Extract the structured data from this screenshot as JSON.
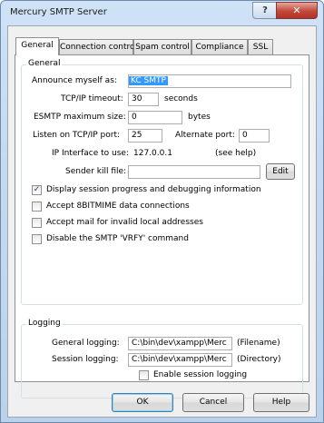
{
  "window": {
    "title": "Mercury SMTP Server",
    "close_glyph": "✕",
    "help_glyph": "?"
  },
  "tabs": [
    "General",
    "Connection control",
    "Spam control",
    "Compliance",
    "SSL"
  ],
  "general": {
    "group_label": "General",
    "announce_label": "Announce myself as:",
    "announce_value": "KC SMTP",
    "timeout_label": "TCP/IP timeout:",
    "timeout_value": "30",
    "timeout_unit": "seconds",
    "esmtp_label": "ESMTP maximum size:",
    "esmtp_value": "0",
    "esmtp_unit": "bytes",
    "port_label": "Listen on TCP/IP port:",
    "port_value": "25",
    "alt_port_label": "Alternate port:",
    "alt_port_value": "0",
    "ip_label": "IP Interface to use:",
    "ip_value": "127.0.0.1",
    "see_help": "(see help)",
    "killfile_label": "Sender kill file:",
    "killfile_value": "",
    "edit_button": "Edit",
    "checkboxes": [
      {
        "label": "Display session progress and debugging information",
        "checked": true
      },
      {
        "label": "Accept 8BITMIME data connections",
        "checked": false
      },
      {
        "label": "Accept mail for invalid local addresses",
        "checked": false
      },
      {
        "label": "Disable the SMTP 'VRFY' command",
        "checked": false
      }
    ],
    "check_glyph": "✓"
  },
  "logging": {
    "group_label": "Logging",
    "general_label": "General logging:",
    "general_value": "C:\\bin\\dev\\xampp\\Merc",
    "general_hint": "(Filename)",
    "session_label": "Session logging:",
    "session_value": "C:\\bin\\dev\\xampp\\Merc",
    "session_hint": "(Directory)",
    "enable_label": "Enable session logging",
    "enable_checked": false
  },
  "buttons": {
    "ok": "OK",
    "cancel": "Cancel",
    "help": "Help"
  }
}
